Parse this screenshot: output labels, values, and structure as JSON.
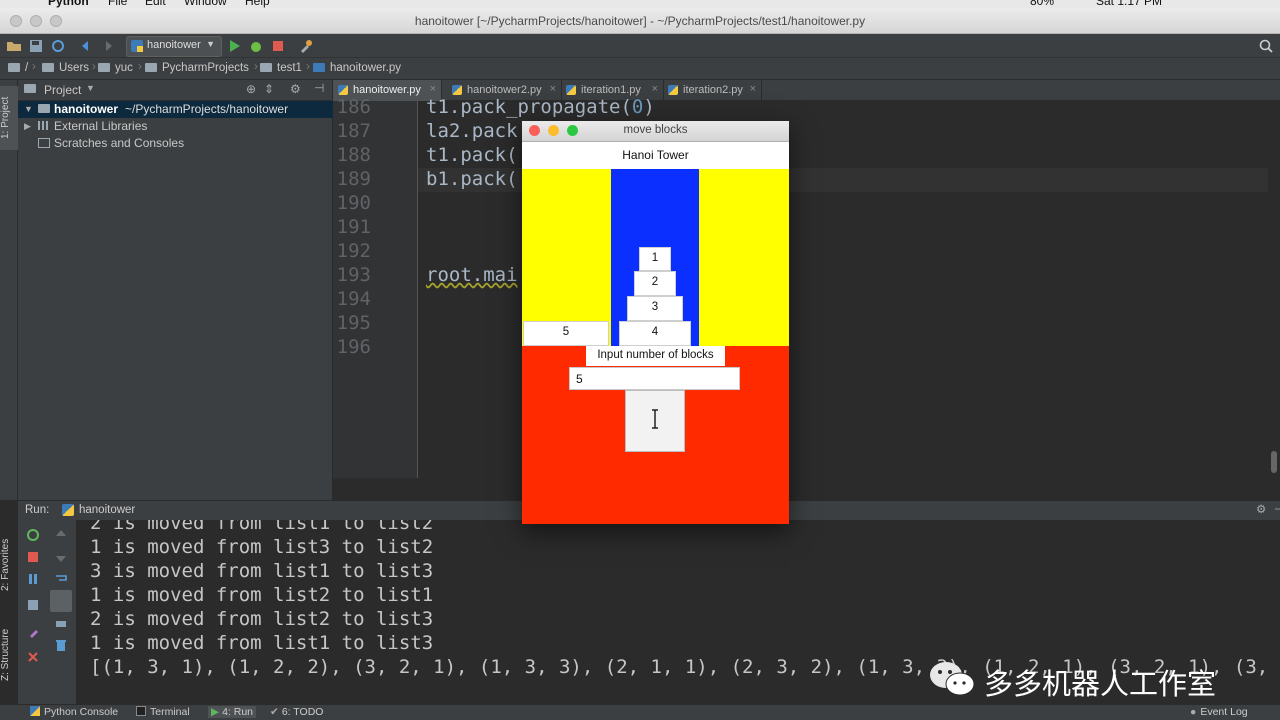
{
  "menubar": {
    "app": "Python",
    "items": [
      "File",
      "Edit",
      "Window",
      "Help"
    ],
    "clock": "Sat 1:17 PM",
    "battery": "80%"
  },
  "window": {
    "title": "hanoitower [~/PycharmProjects/hanoitower] - ~/PycharmProjects/test1/hanoitower.py"
  },
  "toolbar": {
    "run_config": "hanoitower"
  },
  "breadcrumbs": [
    "/",
    "Users",
    "yuc",
    "PycharmProjects",
    "test1",
    "hanoitower.py"
  ],
  "left_strip": {
    "project_tab": "1: Project",
    "favorites_tab": "2: Favorites",
    "structure_tab": "Z: Structure"
  },
  "project_panel": {
    "title": "Project",
    "items": [
      {
        "name": "hanoitower",
        "path": "~/PycharmProjects/hanoitower"
      },
      {
        "name": "External Libraries"
      },
      {
        "name": "Scratches and Consoles"
      }
    ]
  },
  "editor": {
    "tabs": [
      "hanoitower.py",
      "hanoitower2.py",
      "iteration1.py",
      "iteration2.py"
    ],
    "lines": [
      {
        "no": "186",
        "code": "t1.pack_propagate(",
        "num": "0",
        "tail": ")"
      },
      {
        "no": "187",
        "code": "la2.pack",
        "num": "",
        "tail": ""
      },
      {
        "no": "188",
        "code": "t1.pack(",
        "num": "",
        "tail": ""
      },
      {
        "no": "189",
        "code": "b1.pack(",
        "num": "",
        "tail": ""
      },
      {
        "no": "190",
        "code": "",
        "num": "",
        "tail": ""
      },
      {
        "no": "191",
        "code": "",
        "num": "",
        "tail": ""
      },
      {
        "no": "192",
        "code": "",
        "num": "",
        "tail": ""
      },
      {
        "no": "193",
        "code": "root.mai",
        "num": "",
        "tail": ""
      },
      {
        "no": "194",
        "code": "",
        "num": "",
        "tail": ""
      },
      {
        "no": "195",
        "code": "",
        "num": "",
        "tail": ""
      },
      {
        "no": "196",
        "code": "",
        "num": "",
        "tail": ""
      }
    ]
  },
  "run_panel": {
    "label": "Run:",
    "config": "hanoitower",
    "output": [
      "2 is moved from list1 to list2",
      "1 is moved from list3 to list2",
      "3 is moved from list1 to list3",
      "1 is moved from list2 to list1",
      "2 is moved from list2 to list3",
      "1 is moved from list1 to list3",
      "[(1, 3, 1), (1, 2, 2), (3, 2, 1), (1, 3, 3), (2, 1, 1), (2, 3, 2), (1, 3, 3), (1, 2, 1), (3, 2, 1), (3,"
    ]
  },
  "bottom_tabs": {
    "python_console": "Python Console",
    "terminal": "Terminal",
    "run": "4: Run",
    "todo": "6: TODO",
    "event_log": "Event Log"
  },
  "tk_window": {
    "title": "move blocks",
    "header": "Hanoi Tower",
    "disks": [
      "1",
      "2",
      "3",
      "4",
      "5"
    ],
    "input_label": "Input number of blocks",
    "input_value": "5",
    "colors": {
      "yellow": "#ffff00",
      "blue": "#0a2fff",
      "red": "#ff2a00"
    }
  },
  "watermark": {
    "text": "多多机器人工作室"
  }
}
